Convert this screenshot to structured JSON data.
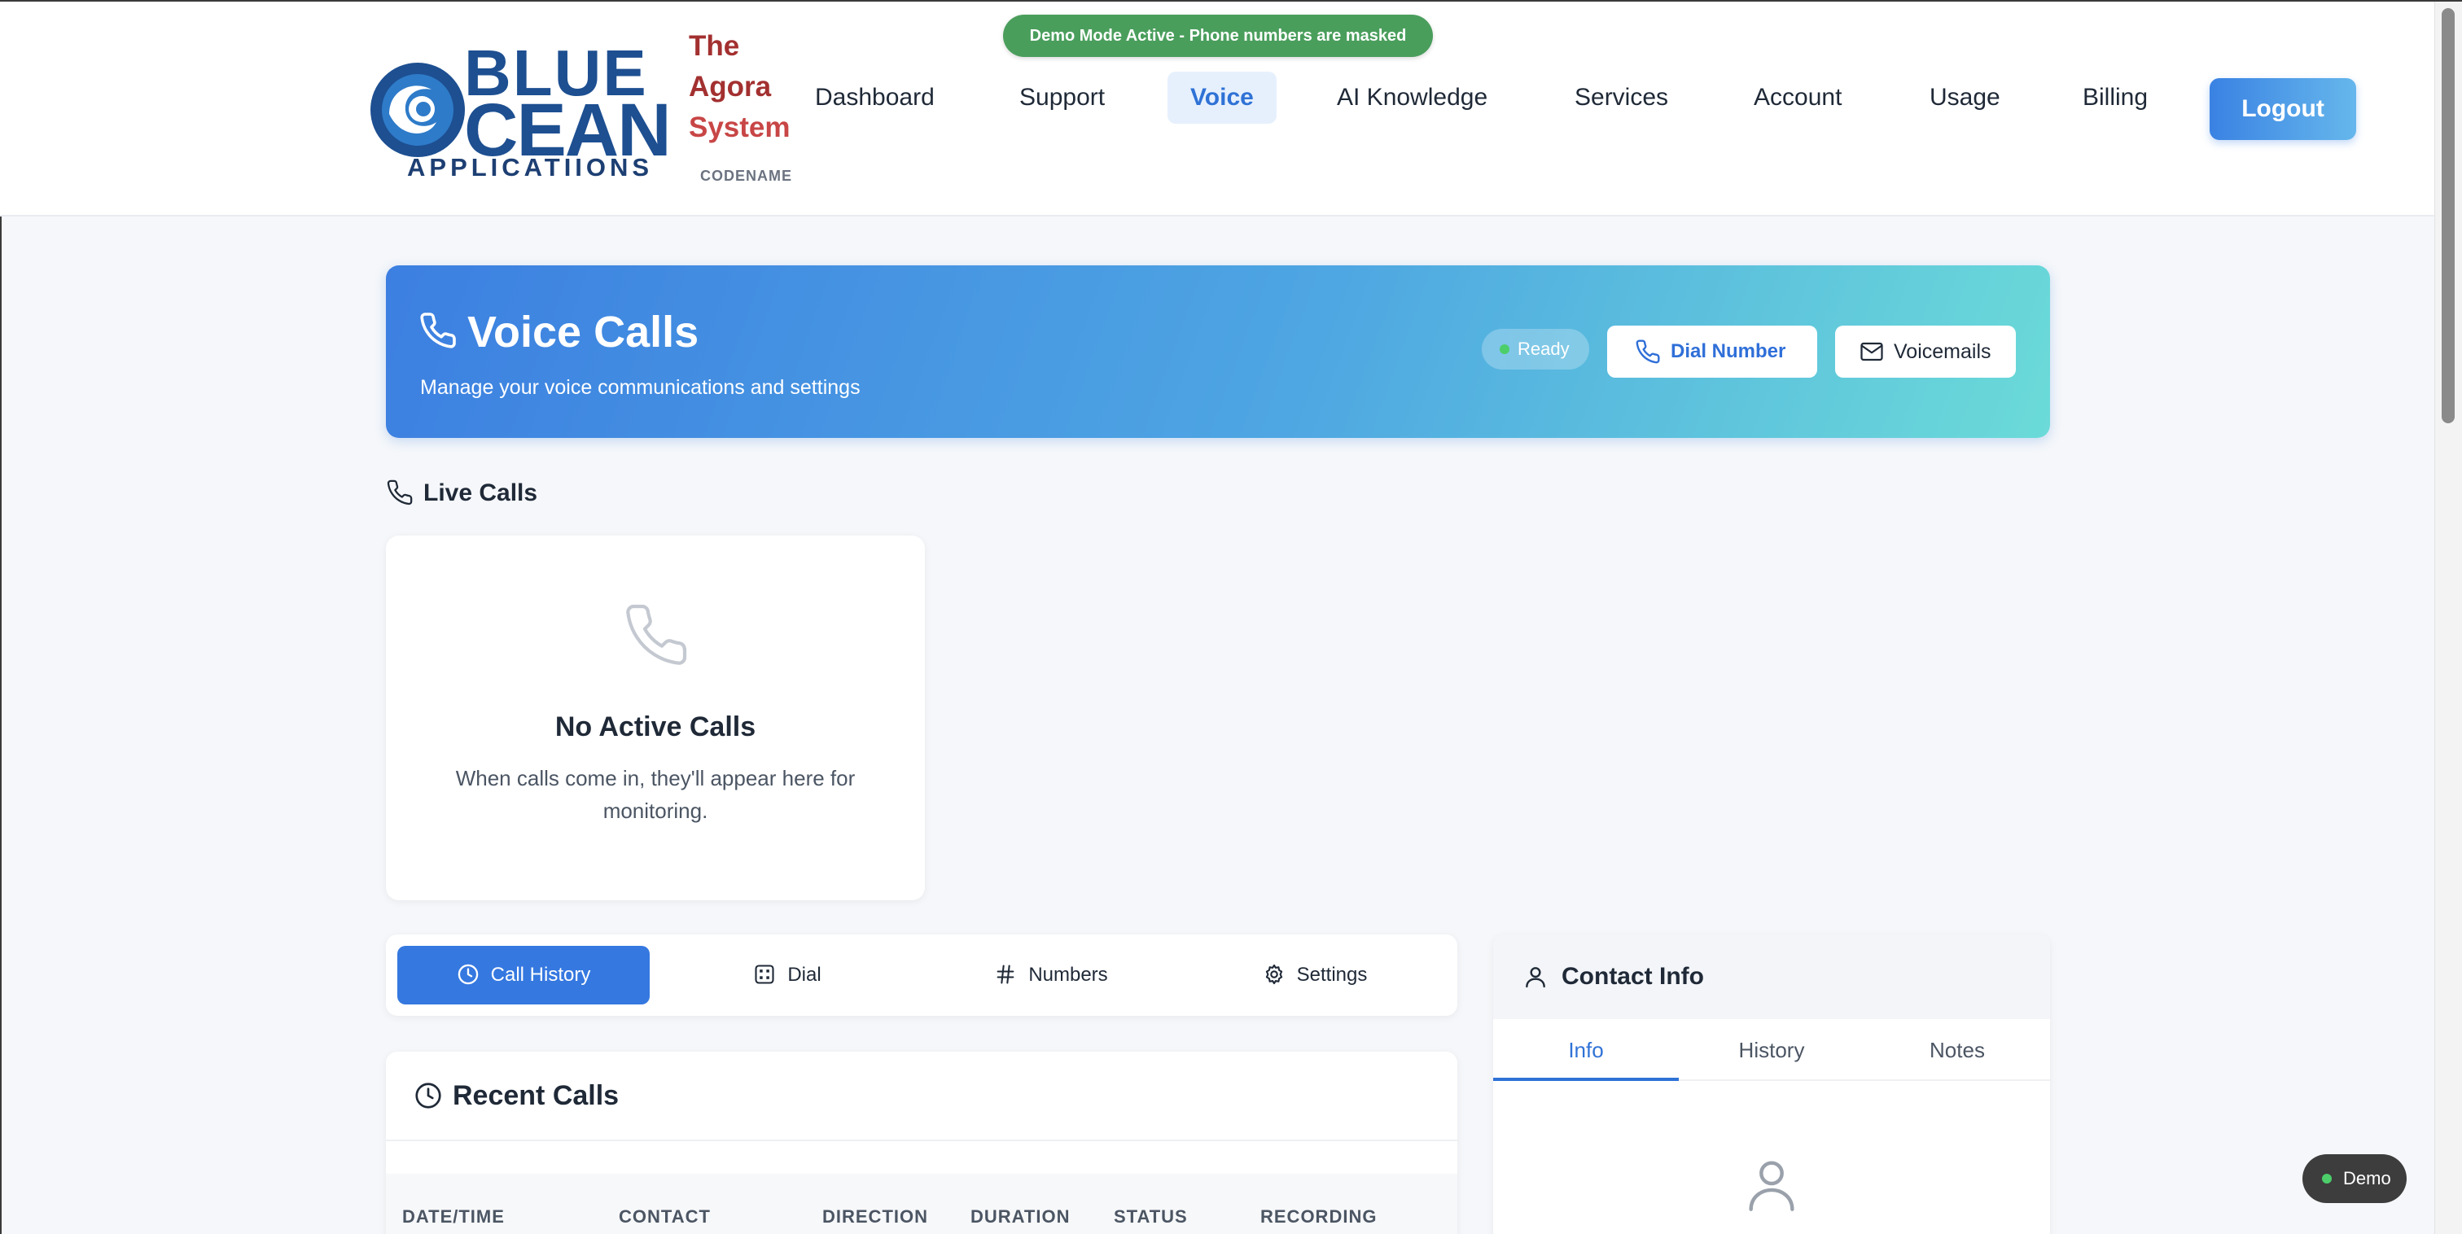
{
  "banner": {
    "text": "Demo Mode Active - Phone numbers are masked"
  },
  "logo": {
    "line1": "BLUE",
    "line2": "CEAN",
    "line3": "APPLICATIIONS"
  },
  "system": {
    "line1": "The",
    "line2": "Agora",
    "line3": "System",
    "codename": "CODENAME"
  },
  "nav": {
    "items": [
      {
        "label": "Dashboard"
      },
      {
        "label": "Support"
      },
      {
        "label": "Voice",
        "active": true
      },
      {
        "label": "AI Knowledge"
      },
      {
        "label": "Services"
      },
      {
        "label": "Account"
      },
      {
        "label": "Usage"
      },
      {
        "label": "Billing"
      }
    ],
    "logout_label": "Logout"
  },
  "hero": {
    "title": "Voice Calls",
    "subtitle": "Manage your voice communications and settings",
    "status": "Ready",
    "dial_label": "Dial Number",
    "voicemail_label": "Voicemails"
  },
  "live_calls": {
    "title": "Live Calls",
    "empty_title": "No Active Calls",
    "empty_text": "When calls come in, they'll appear here for monitoring."
  },
  "tabs": [
    {
      "label": "Call History",
      "icon": "clock-icon",
      "active": true
    },
    {
      "label": "Dial",
      "icon": "dialpad-icon"
    },
    {
      "label": "Numbers",
      "icon": "hash-icon"
    },
    {
      "label": "Settings",
      "icon": "gear-icon"
    }
  ],
  "recent_calls": {
    "title": "Recent Calls",
    "columns": [
      "DATE/TIME",
      "CONTACT",
      "DIRECTION",
      "DURATION",
      "STATUS",
      "RECORDING"
    ]
  },
  "contact": {
    "title": "Contact Info",
    "tabs": [
      {
        "label": "Info",
        "active": true
      },
      {
        "label": "History"
      },
      {
        "label": "Notes"
      }
    ]
  },
  "demo_pill": {
    "label": "Demo"
  },
  "colors": {
    "accent": "#3578e0",
    "banner_green": "#4a9e5c",
    "logo_blue": "#1d4f91",
    "agora_red": "#a33030",
    "status_green": "#4ccf6a"
  }
}
